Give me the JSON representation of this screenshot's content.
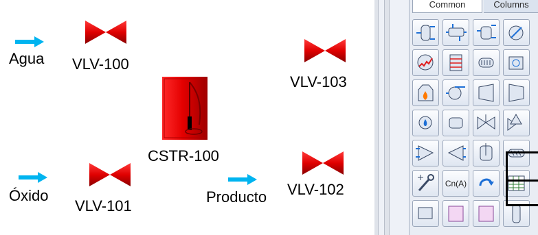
{
  "flowsheet": {
    "streams": {
      "agua": "Agua",
      "oxido": "Óxido",
      "producto": "Producto"
    },
    "valves": {
      "vlv100": "VLV-100",
      "vlv101": "VLV-101",
      "vlv102": "VLV-102",
      "vlv103": "VLV-103"
    },
    "reactor": "CSTR-100"
  },
  "palette": {
    "tabs": [
      "Common",
      "Columns"
    ],
    "active_tab": "Common",
    "cn_label": "Cn(A)",
    "colors": {
      "valve": "#e00000",
      "stream_arrow": "#00b4f0",
      "reactor": "#d40000"
    }
  }
}
